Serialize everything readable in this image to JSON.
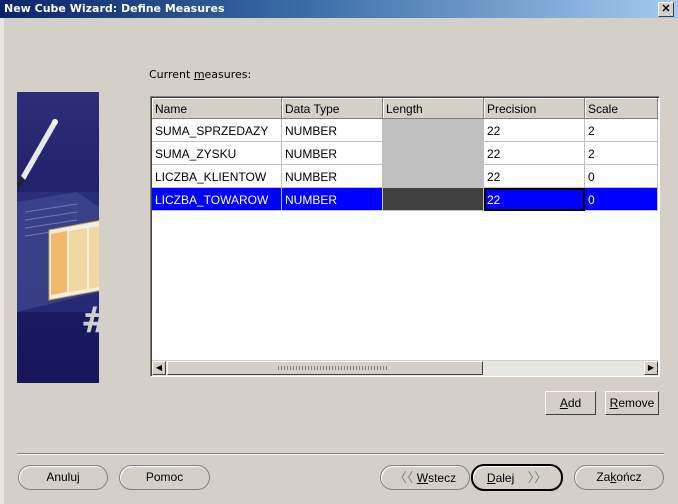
{
  "window": {
    "title": "New Cube Wizard: Define Measures",
    "close_glyph": "✕"
  },
  "measures": {
    "label_prefix": "Current ",
    "label_accel": "m",
    "label_suffix": "easures:",
    "columns": [
      "Name",
      "Data Type",
      "Length",
      "Precision",
      "Scale"
    ],
    "rows": [
      {
        "name": "SUMA_SPRZEDAZY",
        "data_type": "NUMBER",
        "length": "",
        "precision": "22",
        "scale": "2"
      },
      {
        "name": "SUMA_ZYSKU",
        "data_type": "NUMBER",
        "length": "",
        "precision": "22",
        "scale": "2"
      },
      {
        "name": "LICZBA_KLIENTOW",
        "data_type": "NUMBER",
        "length": "",
        "precision": "22",
        "scale": "0"
      },
      {
        "name": "LICZBA_TOWAROW",
        "data_type": "NUMBER",
        "length": "",
        "precision": "22",
        "scale": "0",
        "selected": true
      }
    ]
  },
  "buttons": {
    "add": {
      "accel": "A",
      "rest": "dd"
    },
    "remove": {
      "accel": "R",
      "rest": "emove"
    },
    "cancel": "Anuluj",
    "help": "Pomoc",
    "back": {
      "accel": "W",
      "rest": "stecz",
      "icon": "back-arrow-icon"
    },
    "next": {
      "accel": "D",
      "rest": "alej",
      "icon": "next-arrow-icon"
    },
    "finish": {
      "pre": "Za",
      "accel": "k",
      "rest": "ończ"
    }
  },
  "colors": {
    "selection": "#0000ff",
    "title_start": "#0a246a",
    "title_end": "#a6caf0",
    "panel": "#d4d0c8"
  }
}
